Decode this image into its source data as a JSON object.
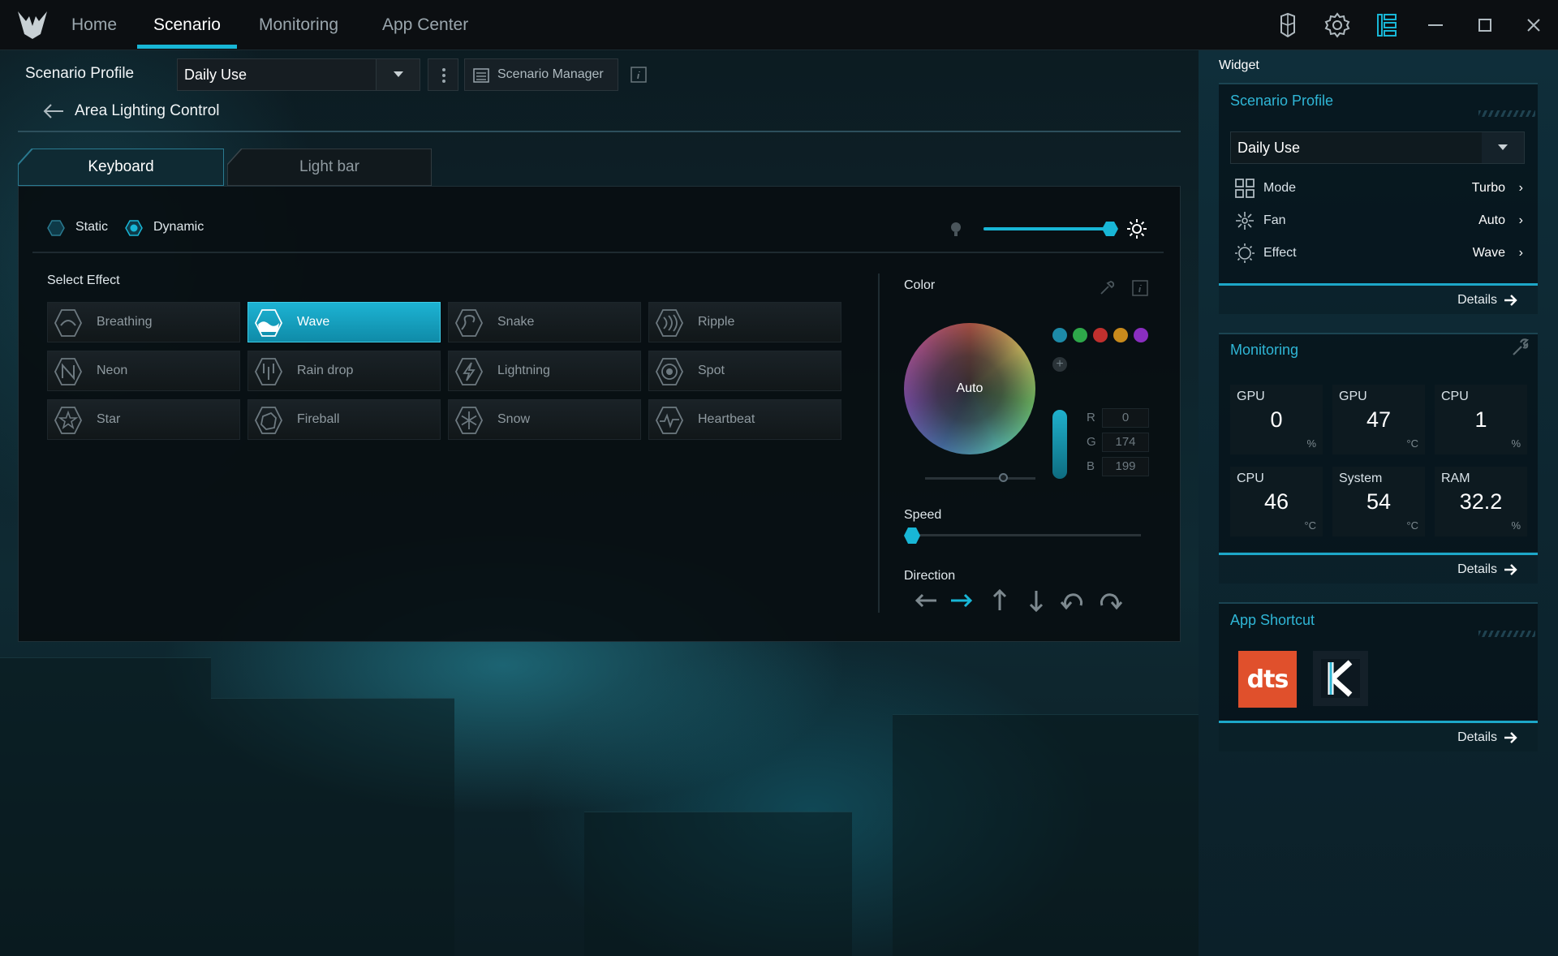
{
  "nav": {
    "tabs": [
      {
        "label": "Home"
      },
      {
        "label": "Scenario",
        "active": true
      },
      {
        "label": "Monitoring"
      },
      {
        "label": "App Center"
      }
    ],
    "icons": [
      "device-icon",
      "gear-icon",
      "widget-layout-icon",
      "minimize-icon",
      "maximize-icon",
      "close-icon"
    ]
  },
  "profile": {
    "label": "Scenario Profile",
    "selected": "Daily Use",
    "manager_label": "Scenario Manager"
  },
  "breadcrumb": {
    "title": "Area Lighting Control"
  },
  "zone_tabs": [
    {
      "label": "Keyboard",
      "active": true
    },
    {
      "label": "Light bar",
      "active": false
    }
  ],
  "lighting_mode": {
    "options": [
      "Static",
      "Dynamic"
    ],
    "selected": "Dynamic",
    "brightness": 1.0
  },
  "effects": {
    "label": "Select Effect",
    "items": [
      "Breathing",
      "Wave",
      "Snake",
      "Ripple",
      "Neon",
      "Rain drop",
      "Lightning",
      "Spot",
      "Star",
      "Fireball",
      "Snow",
      "Heartbeat"
    ],
    "selected": "Wave"
  },
  "color": {
    "label": "Color",
    "wheel_text": "Auto",
    "swatches": [
      "#1d8aa8",
      "#2ea84a",
      "#c0302e",
      "#c88a1c",
      "#8a2ec0"
    ],
    "r_label": "R",
    "r": "0",
    "g_label": "G",
    "g": "174",
    "b_label": "B",
    "b": "199"
  },
  "speed": {
    "label": "Speed",
    "value": 0
  },
  "direction": {
    "label": "Direction",
    "options": [
      "left-arrow-icon",
      "right-arrow-icon",
      "up-arrow-icon",
      "down-arrow-icon",
      "counterclockwise-icon",
      "clockwise-icon"
    ],
    "selected": "right-arrow-icon"
  },
  "widget": {
    "title": "Widget",
    "scenario": {
      "title": "Scenario Profile",
      "selected": "Daily Use",
      "rows": [
        {
          "key": "Mode",
          "value": "Turbo",
          "icon": "mode-grid-icon"
        },
        {
          "key": "Fan",
          "value": "Auto",
          "icon": "fan-icon"
        },
        {
          "key": "Effect",
          "value": "Wave",
          "icon": "effect-icon"
        }
      ],
      "details": "Details"
    },
    "monitoring": {
      "title": "Monitoring",
      "cells": [
        {
          "name": "GPU",
          "value": "0",
          "unit": "%"
        },
        {
          "name": "GPU",
          "value": "47",
          "unit": "°C"
        },
        {
          "name": "CPU",
          "value": "1",
          "unit": "%"
        },
        {
          "name": "CPU",
          "value": "46",
          "unit": "°C"
        },
        {
          "name": "System",
          "value": "54",
          "unit": "°C"
        },
        {
          "name": "RAM",
          "value": "32.2",
          "unit": "%"
        }
      ],
      "details": "Details"
    },
    "shortcut": {
      "title": "App Shortcut",
      "dts_label": "dts",
      "details": "Details"
    }
  },
  "accent_color": "#18b6d6"
}
